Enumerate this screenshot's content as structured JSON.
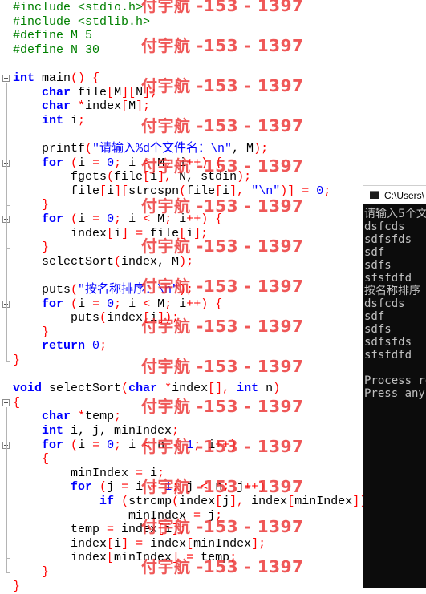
{
  "editor": {
    "lines": [
      [
        {
          "t": "#include <stdio.h>",
          "c": "pre"
        }
      ],
      [
        {
          "t": "#include <stdlib.h>",
          "c": "pre"
        }
      ],
      [
        {
          "t": "#define M 5",
          "c": "pre"
        }
      ],
      [
        {
          "t": "#define N 30",
          "c": "pre"
        }
      ],
      [],
      [
        {
          "t": "int",
          "c": "kw"
        },
        {
          "t": " main",
          "c": "pl"
        },
        {
          "t": "()",
          "c": "op"
        },
        {
          "t": " ",
          "c": "pl"
        },
        {
          "t": "{",
          "c": "op"
        }
      ],
      [
        {
          "t": "    ",
          "c": "pl"
        },
        {
          "t": "char",
          "c": "kw"
        },
        {
          "t": " file",
          "c": "pl"
        },
        {
          "t": "[",
          "c": "op"
        },
        {
          "t": "M",
          "c": "pl"
        },
        {
          "t": "][",
          "c": "op"
        },
        {
          "t": "N",
          "c": "pl"
        },
        {
          "t": "];",
          "c": "op"
        }
      ],
      [
        {
          "t": "    ",
          "c": "pl"
        },
        {
          "t": "char",
          "c": "kw"
        },
        {
          "t": " ",
          "c": "pl"
        },
        {
          "t": "*",
          "c": "op"
        },
        {
          "t": "index",
          "c": "pl"
        },
        {
          "t": "[",
          "c": "op"
        },
        {
          "t": "M",
          "c": "pl"
        },
        {
          "t": "];",
          "c": "op"
        }
      ],
      [
        {
          "t": "    ",
          "c": "pl"
        },
        {
          "t": "int",
          "c": "kw"
        },
        {
          "t": " i",
          "c": "pl"
        },
        {
          "t": ";",
          "c": "op"
        }
      ],
      [],
      [
        {
          "t": "    printf",
          "c": "pl"
        },
        {
          "t": "(",
          "c": "op"
        },
        {
          "t": "\"请输入%d个文件名：\\n\"",
          "c": "str"
        },
        {
          "t": ", M",
          "c": "pl"
        },
        {
          "t": ");",
          "c": "op"
        }
      ],
      [
        {
          "t": "    ",
          "c": "pl"
        },
        {
          "t": "for",
          "c": "kw"
        },
        {
          "t": " ",
          "c": "pl"
        },
        {
          "t": "(",
          "c": "op"
        },
        {
          "t": "i ",
          "c": "pl"
        },
        {
          "t": "=",
          "c": "op"
        },
        {
          "t": " ",
          "c": "pl"
        },
        {
          "t": "0",
          "c": "num"
        },
        {
          "t": ";",
          "c": "op"
        },
        {
          "t": " i ",
          "c": "pl"
        },
        {
          "t": "<",
          "c": "op"
        },
        {
          "t": " M",
          "c": "pl"
        },
        {
          "t": ";",
          "c": "op"
        },
        {
          "t": " i",
          "c": "pl"
        },
        {
          "t": "++)",
          "c": "op"
        },
        {
          "t": " ",
          "c": "pl"
        },
        {
          "t": "{",
          "c": "op"
        }
      ],
      [
        {
          "t": "        fgets",
          "c": "pl"
        },
        {
          "t": "(",
          "c": "op"
        },
        {
          "t": "file",
          "c": "pl"
        },
        {
          "t": "[",
          "c": "op"
        },
        {
          "t": "i",
          "c": "pl"
        },
        {
          "t": "],",
          "c": "op"
        },
        {
          "t": " N, stdin",
          "c": "pl"
        },
        {
          "t": ");",
          "c": "op"
        }
      ],
      [
        {
          "t": "        file",
          "c": "pl"
        },
        {
          "t": "[",
          "c": "op"
        },
        {
          "t": "i",
          "c": "pl"
        },
        {
          "t": "][",
          "c": "op"
        },
        {
          "t": "strcspn",
          "c": "pl"
        },
        {
          "t": "(",
          "c": "op"
        },
        {
          "t": "file",
          "c": "pl"
        },
        {
          "t": "[",
          "c": "op"
        },
        {
          "t": "i",
          "c": "pl"
        },
        {
          "t": "],",
          "c": "op"
        },
        {
          "t": " ",
          "c": "pl"
        },
        {
          "t": "\"\\n\"",
          "c": "str"
        },
        {
          "t": ")]",
          "c": "op"
        },
        {
          "t": " ",
          "c": "pl"
        },
        {
          "t": "=",
          "c": "op"
        },
        {
          "t": " ",
          "c": "pl"
        },
        {
          "t": "0",
          "c": "num"
        },
        {
          "t": ";",
          "c": "op"
        }
      ],
      [
        {
          "t": "    ",
          "c": "pl"
        },
        {
          "t": "}",
          "c": "op"
        }
      ],
      [
        {
          "t": "    ",
          "c": "pl"
        },
        {
          "t": "for",
          "c": "kw"
        },
        {
          "t": " ",
          "c": "pl"
        },
        {
          "t": "(",
          "c": "op"
        },
        {
          "t": "i ",
          "c": "pl"
        },
        {
          "t": "=",
          "c": "op"
        },
        {
          "t": " ",
          "c": "pl"
        },
        {
          "t": "0",
          "c": "num"
        },
        {
          "t": ";",
          "c": "op"
        },
        {
          "t": " i ",
          "c": "pl"
        },
        {
          "t": "<",
          "c": "op"
        },
        {
          "t": " M",
          "c": "pl"
        },
        {
          "t": ";",
          "c": "op"
        },
        {
          "t": " i",
          "c": "pl"
        },
        {
          "t": "++)",
          "c": "op"
        },
        {
          "t": " ",
          "c": "pl"
        },
        {
          "t": "{",
          "c": "op"
        }
      ],
      [
        {
          "t": "        index",
          "c": "pl"
        },
        {
          "t": "[",
          "c": "op"
        },
        {
          "t": "i",
          "c": "pl"
        },
        {
          "t": "]",
          "c": "op"
        },
        {
          "t": " ",
          "c": "pl"
        },
        {
          "t": "=",
          "c": "op"
        },
        {
          "t": " file",
          "c": "pl"
        },
        {
          "t": "[",
          "c": "op"
        },
        {
          "t": "i",
          "c": "pl"
        },
        {
          "t": "];",
          "c": "op"
        }
      ],
      [
        {
          "t": "    ",
          "c": "pl"
        },
        {
          "t": "}",
          "c": "op"
        }
      ],
      [
        {
          "t": "    selectSort",
          "c": "pl"
        },
        {
          "t": "(",
          "c": "op"
        },
        {
          "t": "index, M",
          "c": "pl"
        },
        {
          "t": ");",
          "c": "op"
        }
      ],
      [],
      [
        {
          "t": "    puts",
          "c": "pl"
        },
        {
          "t": "(",
          "c": "op"
        },
        {
          "t": "\"按名称排序：\\n\"",
          "c": "str"
        },
        {
          "t": ");",
          "c": "op"
        }
      ],
      [
        {
          "t": "    ",
          "c": "pl"
        },
        {
          "t": "for",
          "c": "kw"
        },
        {
          "t": " ",
          "c": "pl"
        },
        {
          "t": "(",
          "c": "op"
        },
        {
          "t": "i ",
          "c": "pl"
        },
        {
          "t": "=",
          "c": "op"
        },
        {
          "t": " ",
          "c": "pl"
        },
        {
          "t": "0",
          "c": "num"
        },
        {
          "t": ";",
          "c": "op"
        },
        {
          "t": " i ",
          "c": "pl"
        },
        {
          "t": "<",
          "c": "op"
        },
        {
          "t": " M",
          "c": "pl"
        },
        {
          "t": ";",
          "c": "op"
        },
        {
          "t": " i",
          "c": "pl"
        },
        {
          "t": "++)",
          "c": "op"
        },
        {
          "t": " ",
          "c": "pl"
        },
        {
          "t": "{",
          "c": "op"
        }
      ],
      [
        {
          "t": "        puts",
          "c": "pl"
        },
        {
          "t": "(",
          "c": "op"
        },
        {
          "t": "index",
          "c": "pl"
        },
        {
          "t": "[",
          "c": "op"
        },
        {
          "t": "i",
          "c": "pl"
        },
        {
          "t": "]);",
          "c": "op"
        }
      ],
      [
        {
          "t": "    ",
          "c": "pl"
        },
        {
          "t": "}",
          "c": "op"
        }
      ],
      [
        {
          "t": "    ",
          "c": "pl"
        },
        {
          "t": "return",
          "c": "kw"
        },
        {
          "t": " ",
          "c": "pl"
        },
        {
          "t": "0",
          "c": "num"
        },
        {
          "t": ";",
          "c": "op"
        }
      ],
      [
        {
          "t": "}",
          "c": "op"
        }
      ],
      [],
      [
        {
          "t": "void",
          "c": "kw"
        },
        {
          "t": " selectSort",
          "c": "pl"
        },
        {
          "t": "(",
          "c": "op"
        },
        {
          "t": "char",
          "c": "kw"
        },
        {
          "t": " ",
          "c": "pl"
        },
        {
          "t": "*",
          "c": "op"
        },
        {
          "t": "index",
          "c": "pl"
        },
        {
          "t": "[],",
          "c": "op"
        },
        {
          "t": " ",
          "c": "pl"
        },
        {
          "t": "int",
          "c": "kw"
        },
        {
          "t": " n",
          "c": "pl"
        },
        {
          "t": ")",
          "c": "op"
        }
      ],
      [
        {
          "t": "{",
          "c": "op"
        }
      ],
      [
        {
          "t": "    ",
          "c": "pl"
        },
        {
          "t": "char",
          "c": "kw"
        },
        {
          "t": " ",
          "c": "pl"
        },
        {
          "t": "*",
          "c": "op"
        },
        {
          "t": "temp",
          "c": "pl"
        },
        {
          "t": ";",
          "c": "op"
        }
      ],
      [
        {
          "t": "    ",
          "c": "pl"
        },
        {
          "t": "int",
          "c": "kw"
        },
        {
          "t": " i, j, minIndex",
          "c": "pl"
        },
        {
          "t": ";",
          "c": "op"
        }
      ],
      [
        {
          "t": "    ",
          "c": "pl"
        },
        {
          "t": "for",
          "c": "kw"
        },
        {
          "t": " ",
          "c": "pl"
        },
        {
          "t": "(",
          "c": "op"
        },
        {
          "t": "i ",
          "c": "pl"
        },
        {
          "t": "=",
          "c": "op"
        },
        {
          "t": " ",
          "c": "pl"
        },
        {
          "t": "0",
          "c": "num"
        },
        {
          "t": ";",
          "c": "op"
        },
        {
          "t": " i ",
          "c": "pl"
        },
        {
          "t": "<",
          "c": "op"
        },
        {
          "t": " n ",
          "c": "pl"
        },
        {
          "t": "-",
          "c": "op"
        },
        {
          "t": " ",
          "c": "pl"
        },
        {
          "t": "1",
          "c": "num"
        },
        {
          "t": ";",
          "c": "op"
        },
        {
          "t": " i",
          "c": "pl"
        },
        {
          "t": "++)",
          "c": "op"
        }
      ],
      [
        {
          "t": "    ",
          "c": "pl"
        },
        {
          "t": "{",
          "c": "op"
        }
      ],
      [
        {
          "t": "        minIndex ",
          "c": "pl"
        },
        {
          "t": "=",
          "c": "op"
        },
        {
          "t": " i",
          "c": "pl"
        },
        {
          "t": ";",
          "c": "op"
        }
      ],
      [
        {
          "t": "        ",
          "c": "pl"
        },
        {
          "t": "for",
          "c": "kw"
        },
        {
          "t": " ",
          "c": "pl"
        },
        {
          "t": "(",
          "c": "op"
        },
        {
          "t": "j ",
          "c": "pl"
        },
        {
          "t": "=",
          "c": "op"
        },
        {
          "t": " i ",
          "c": "pl"
        },
        {
          "t": "+",
          "c": "op"
        },
        {
          "t": " ",
          "c": "pl"
        },
        {
          "t": "1",
          "c": "num"
        },
        {
          "t": ";",
          "c": "op"
        },
        {
          "t": " j ",
          "c": "pl"
        },
        {
          "t": "<",
          "c": "op"
        },
        {
          "t": " n",
          "c": "pl"
        },
        {
          "t": ";",
          "c": "op"
        },
        {
          "t": " j",
          "c": "pl"
        },
        {
          "t": "++)",
          "c": "op"
        }
      ],
      [
        {
          "t": "            ",
          "c": "pl"
        },
        {
          "t": "if",
          "c": "kw"
        },
        {
          "t": " ",
          "c": "pl"
        },
        {
          "t": "(",
          "c": "op"
        },
        {
          "t": "strcmp",
          "c": "pl"
        },
        {
          "t": "(",
          "c": "op"
        },
        {
          "t": "index",
          "c": "pl"
        },
        {
          "t": "[",
          "c": "op"
        },
        {
          "t": "j",
          "c": "pl"
        },
        {
          "t": "],",
          "c": "op"
        },
        {
          "t": " index",
          "c": "pl"
        },
        {
          "t": "[",
          "c": "op"
        },
        {
          "t": "minIndex",
          "c": "pl"
        },
        {
          "t": "])",
          "c": "op"
        }
      ],
      [
        {
          "t": "                minIndex ",
          "c": "pl"
        },
        {
          "t": "=",
          "c": "op"
        },
        {
          "t": " j",
          "c": "pl"
        },
        {
          "t": ";",
          "c": "op"
        }
      ],
      [
        {
          "t": "        temp ",
          "c": "pl"
        },
        {
          "t": "=",
          "c": "op"
        },
        {
          "t": " index",
          "c": "pl"
        },
        {
          "t": "[",
          "c": "op"
        },
        {
          "t": "i",
          "c": "pl"
        },
        {
          "t": "];",
          "c": "op"
        }
      ],
      [
        {
          "t": "        index",
          "c": "pl"
        },
        {
          "t": "[",
          "c": "op"
        },
        {
          "t": "i",
          "c": "pl"
        },
        {
          "t": "]",
          "c": "op"
        },
        {
          "t": " ",
          "c": "pl"
        },
        {
          "t": "=",
          "c": "op"
        },
        {
          "t": " index",
          "c": "pl"
        },
        {
          "t": "[",
          "c": "op"
        },
        {
          "t": "minIndex",
          "c": "pl"
        },
        {
          "t": "];",
          "c": "op"
        }
      ],
      [
        {
          "t": "        index",
          "c": "pl"
        },
        {
          "t": "[",
          "c": "op"
        },
        {
          "t": "minIndex",
          "c": "pl"
        },
        {
          "t": "]",
          "c": "op"
        },
        {
          "t": " ",
          "c": "pl"
        },
        {
          "t": "=",
          "c": "op"
        },
        {
          "t": " temp",
          "c": "pl"
        },
        {
          "t": ";",
          "c": "op"
        }
      ],
      [
        {
          "t": "    ",
          "c": "pl"
        },
        {
          "t": "}",
          "c": "op"
        }
      ],
      [
        {
          "t": "}",
          "c": "op"
        }
      ]
    ]
  },
  "watermark": {
    "text": "付宇航 -153 - 1397",
    "count": 15
  },
  "console": {
    "title": "C:\\Users\\",
    "lines": [
      "请输入5个文",
      "dsfcds",
      "sdfsfds",
      "sdf",
      "sdfs",
      "sfsfdfd",
      "按名称排序",
      "dsfcds",
      "sdf",
      "sdfs",
      "sdfsfds",
      "sfsfdfd",
      "",
      "Process re",
      "Press any"
    ]
  },
  "colors": {
    "keyword": "#0000ff",
    "preprocessor": "#008000",
    "operator": "#ff0000",
    "string": "#0000ff",
    "watermark": "#eb3232",
    "console_bg": "#0c0c0c",
    "console_text": "#c0c0c0"
  },
  "icons": {
    "fold_marker": "fold-minus-icon",
    "console_window": "console-window-icon"
  }
}
